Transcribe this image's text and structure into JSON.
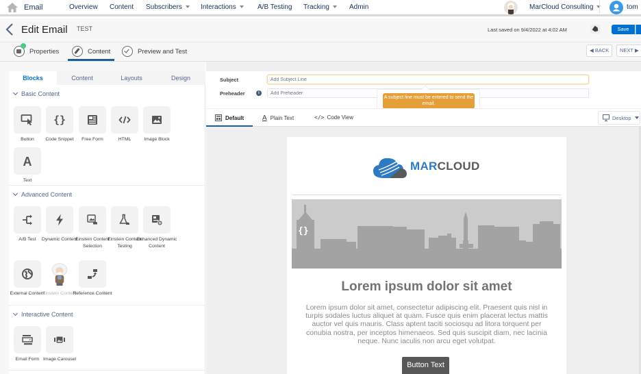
{
  "topnav": {
    "app_name": "Email",
    "items": [
      {
        "label": "Overview",
        "has_menu": false
      },
      {
        "label": "Content",
        "has_menu": false
      },
      {
        "label": "Subscribers",
        "has_menu": true
      },
      {
        "label": "Interactions",
        "has_menu": true
      },
      {
        "label": "A/B Testing",
        "has_menu": false
      },
      {
        "label": "Tracking",
        "has_menu": true
      },
      {
        "label": "Admin",
        "has_menu": false
      }
    ],
    "org_name": "MarCloud Consulting",
    "user_name": "tom"
  },
  "header": {
    "title": "Edit Email",
    "subtitle": "TEST",
    "last_saved": "Last saved on 9/4/2022 at 4:02 AM",
    "save_label": "Save"
  },
  "steps": {
    "items": [
      {
        "label": "Properties",
        "state": "complete"
      },
      {
        "label": "Content",
        "state": "active"
      },
      {
        "label": "Preview and Test",
        "state": "pending"
      }
    ],
    "back_label": "BACK",
    "next_label": "NEXT"
  },
  "left_panel": {
    "tabs": [
      "Blocks",
      "Content",
      "Layouts",
      "Design"
    ],
    "active_tab": "Blocks",
    "sections": [
      {
        "title": "Basic Content",
        "blocks": [
          {
            "label": "Button",
            "icon": "button-click-icon"
          },
          {
            "label": "Code Snippet",
            "icon": "curly-braces-icon"
          },
          {
            "label": "Free Form",
            "icon": "free-form-icon"
          },
          {
            "label": "HTML",
            "icon": "code-icon"
          },
          {
            "label": "Image Block",
            "icon": "image-icon"
          },
          {
            "label": "Text",
            "icon": "text-icon"
          }
        ]
      },
      {
        "title": "Advanced Content",
        "blocks": [
          {
            "label": "A/B Test",
            "icon": "ab-test-icon"
          },
          {
            "label": "Dynamic Content",
            "icon": "lightning-icon"
          },
          {
            "label": "Einstein Content Selection",
            "icon": "einstein-selection-icon"
          },
          {
            "label": "Einstein Content Testing",
            "icon": "flask-icon"
          },
          {
            "label": "Enhanced Dynamic Content",
            "icon": "enhanced-dynamic-icon"
          },
          {
            "label": "External Content",
            "icon": "globe-icon"
          },
          {
            "label": "Einstein Content",
            "icon": "einstein-avatar-icon",
            "disabled": true
          },
          {
            "label": "Reference Content",
            "icon": "reference-icon"
          }
        ]
      },
      {
        "title": "Interactive Content",
        "blocks": [
          {
            "label": "Email Form",
            "icon": "email-form-icon"
          },
          {
            "label": "Image Carousel",
            "icon": "carousel-icon"
          }
        ]
      }
    ]
  },
  "fields": {
    "subject_label": "Subject",
    "subject_placeholder": "Add Subject Line",
    "subject_value": "",
    "preheader_label": "Preheader",
    "preheader_placeholder": "Add Preheader",
    "preheader_value": "",
    "tooltip": "A subject line must be entered to send the email."
  },
  "view_tabs": {
    "items": [
      "Default",
      "Plain Text",
      "Code View"
    ],
    "active": "Default",
    "device": "Desktop"
  },
  "email": {
    "brand_prefix": "MAR",
    "brand_suffix": "CLOUD",
    "heading": "Lorem ipsum dolor sit amet",
    "body": "Lorem ipsum dolor sit amet, consectetur adipiscing elit. Praesent quis nisl in turpis sodales luctus aliquet at quam. Fusce quis enim placerat lectus mattis auctor vel quis mauris. Class aptent taciti sociosqu ad litora torquent per conubia nostra, per inceptos himenaeos. Sed quis suscipit diam, nec lacinia neque. Nunc iaculis non arcu eget volutpat.",
    "button_text": "Button Text",
    "code_badge": "{}"
  },
  "colors": {
    "brand_blue": "#2e7bc4",
    "brand_gray": "#58595b",
    "primary": "#0070d2",
    "warning": "#e39a2f"
  }
}
